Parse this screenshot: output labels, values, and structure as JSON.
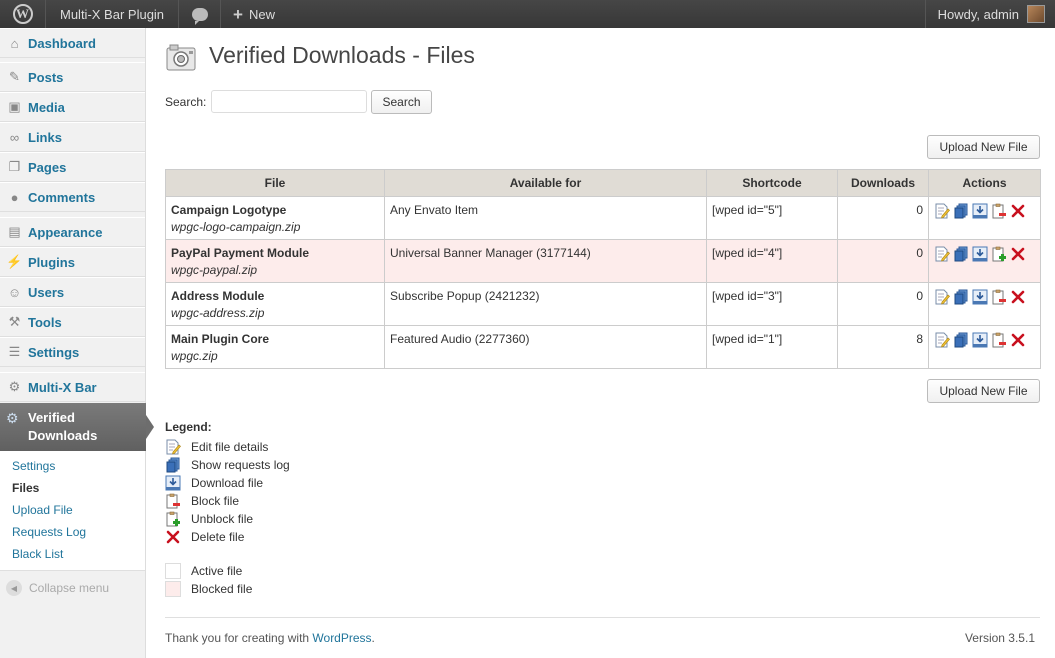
{
  "adminbar": {
    "site_name": "Multi-X Bar Plugin",
    "new_label": "New",
    "howdy": "Howdy, admin"
  },
  "sidebar": {
    "items": [
      {
        "label": "Dashboard",
        "icon": "dashboard-icon"
      },
      {
        "label": "Posts",
        "icon": "pin-icon"
      },
      {
        "label": "Media",
        "icon": "media-icon"
      },
      {
        "label": "Links",
        "icon": "link-icon"
      },
      {
        "label": "Pages",
        "icon": "pages-icon"
      },
      {
        "label": "Comments",
        "icon": "comment-icon"
      },
      {
        "label": "Appearance",
        "icon": "appearance-icon"
      },
      {
        "label": "Plugins",
        "icon": "plug-icon"
      },
      {
        "label": "Users",
        "icon": "users-icon"
      },
      {
        "label": "Tools",
        "icon": "tools-icon"
      },
      {
        "label": "Settings",
        "icon": "settings-icon"
      },
      {
        "label": "Multi-X Bar",
        "icon": "gear-icon"
      }
    ],
    "current": {
      "label_line1": "Verified",
      "label_line2": "Downloads",
      "icon": "gear-icon"
    },
    "submenu": [
      "Settings",
      "Files",
      "Upload File",
      "Requests Log",
      "Black List"
    ],
    "collapse_label": "Collapse menu"
  },
  "page": {
    "title": "Verified Downloads - Files",
    "search_label": "Search:",
    "search_value": "",
    "search_button": "Search",
    "upload_button": "Upload New File"
  },
  "table": {
    "headers": [
      "File",
      "Available for",
      "Shortcode",
      "Downloads",
      "Actions"
    ],
    "rows": [
      {
        "name": "Campaign Logotype",
        "file": "wpgc-logo-campaign.zip",
        "available": "Any Envato Item",
        "shortcode": "[wped id=\"5\"]",
        "downloads": "0",
        "status": "active"
      },
      {
        "name": "PayPal Payment Module",
        "file": "wpgc-paypal.zip",
        "available": "Universal Banner Manager (3177144)",
        "shortcode": "[wped id=\"4\"]",
        "downloads": "0",
        "status": "blocked"
      },
      {
        "name": "Address Module",
        "file": "wpgc-address.zip",
        "available": "Subscribe Popup (2421232)",
        "shortcode": "[wped id=\"3\"]",
        "downloads": "0",
        "status": "active"
      },
      {
        "name": "Main Plugin Core",
        "file": "wpgc.zip",
        "available": "Featured Audio (2277360)",
        "shortcode": "[wped id=\"1\"]",
        "downloads": "8",
        "status": "active"
      }
    ]
  },
  "legend": {
    "title": "Legend:",
    "items": [
      "Edit file details",
      "Show requests log",
      "Download file",
      "Block file",
      "Unblock file",
      "Delete file"
    ],
    "active_file": "Active file",
    "blocked_file": "Blocked file"
  },
  "footer": {
    "thanks_prefix": "Thank you for creating with ",
    "wordpress_link": "WordPress",
    "thanks_suffix": ".",
    "version": "Version 3.5.1"
  },
  "colors": {
    "link": "#21759b",
    "blocked_row": "#fdeceb",
    "header_bg": "#e0dcd5"
  }
}
